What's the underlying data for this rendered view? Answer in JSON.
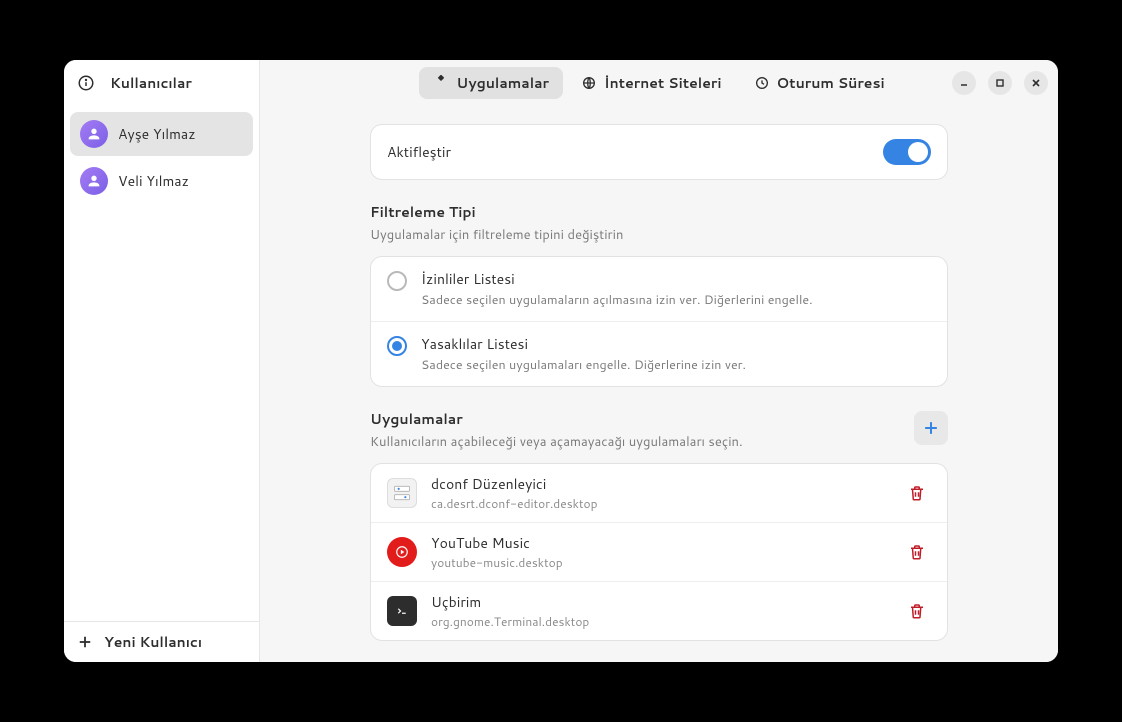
{
  "sidebar": {
    "title": "Kullanıcılar",
    "users": [
      {
        "name": "Ayşe Yılmaz",
        "active": true
      },
      {
        "name": "Veli Yılmaz",
        "active": false
      }
    ],
    "new_user_label": "Yeni Kullanıcı"
  },
  "tabs": [
    {
      "label": "Uygulamalar",
      "icon": "apps-icon",
      "active": true
    },
    {
      "label": "İnternet Siteleri",
      "icon": "globe-icon",
      "active": false
    },
    {
      "label": "Oturum Süresi",
      "icon": "clock-icon",
      "active": false
    }
  ],
  "activate": {
    "label": "Aktifleştir",
    "enabled": true
  },
  "filter_section": {
    "title": "Filtreleme Tipi",
    "subtitle": "Uygulamalar için filtreleme tipini değiştirin",
    "options": [
      {
        "title": "İzinliler Listesi",
        "desc": "Sadece seçilen uygulamaların açılmasına izin ver. Diğerlerini engelle.",
        "selected": false
      },
      {
        "title": "Yasaklılar Listesi",
        "desc": "Sadece seçilen uygulamaları engelle. Diğerlerine izin ver.",
        "selected": true
      }
    ]
  },
  "apps_section": {
    "title": "Uygulamalar",
    "subtitle": "Kullanıcıların açabileceği veya açamayacağı uygulamaları seçin.",
    "apps": [
      {
        "name": "dconf Düzenleyici",
        "id": "ca.desrt.dconf-editor.desktop",
        "icon": "dconf"
      },
      {
        "name": "YouTube Music",
        "id": "youtube-music.desktop",
        "icon": "youtube"
      },
      {
        "name": "Uçbirim",
        "id": "org.gnome.Terminal.desktop",
        "icon": "terminal"
      }
    ]
  }
}
